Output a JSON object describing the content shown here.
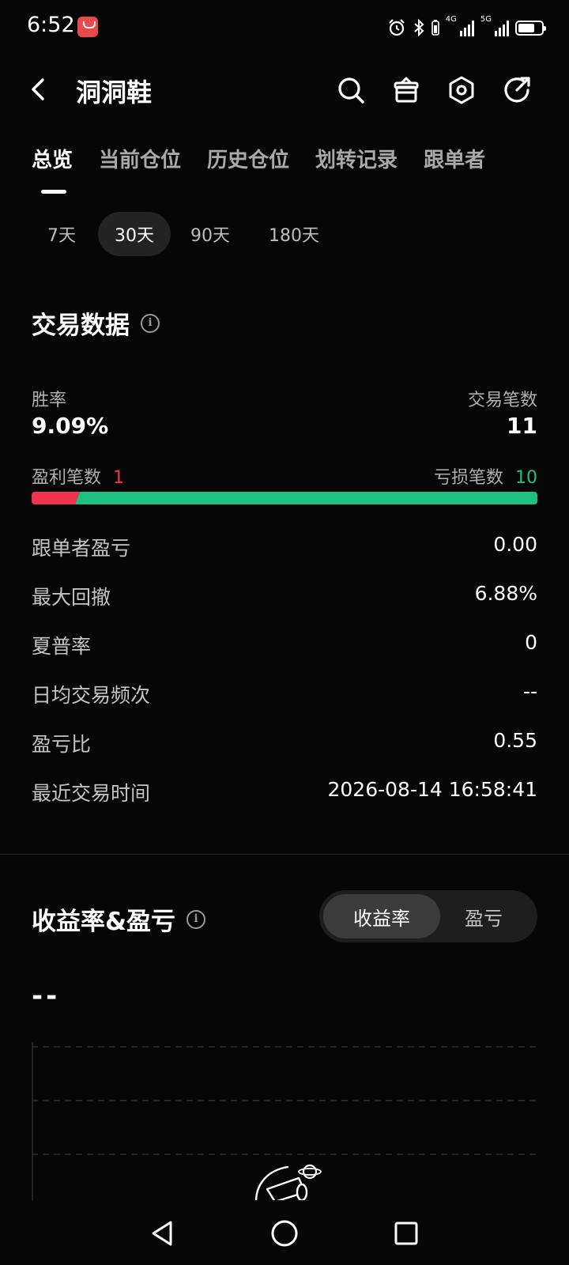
{
  "status_bar": {
    "time": "6:52",
    "network_1": "4G",
    "network_2": "5G"
  },
  "header": {
    "title": "洞洞鞋",
    "icons": [
      "back-icon",
      "search-icon",
      "gift-icon",
      "settings-icon",
      "share-icon"
    ]
  },
  "tabs": [
    {
      "label": "总览",
      "active": true
    },
    {
      "label": "当前仓位",
      "active": false
    },
    {
      "label": "历史仓位",
      "active": false
    },
    {
      "label": "划转记录",
      "active": false
    },
    {
      "label": "跟单者",
      "active": false
    }
  ],
  "periods": [
    {
      "label": "7天",
      "active": false
    },
    {
      "label": "30天",
      "active": true
    },
    {
      "label": "90天",
      "active": false
    },
    {
      "label": "180天",
      "active": false
    }
  ],
  "trading_data": {
    "title": "交易数据",
    "win_rate_label": "胜率",
    "win_rate": "9.09%",
    "trade_count_label": "交易笔数",
    "trade_count": "11",
    "profit_trades_label": "盈利笔数",
    "profit_trades": "1",
    "loss_trades_label": "亏损笔数",
    "loss_trades": "10",
    "profit_ratio": 0.0909,
    "rows": [
      {
        "key": "跟单者盈亏",
        "value": "0.00"
      },
      {
        "key": "最大回撤",
        "value": "6.88%"
      },
      {
        "key": "夏普率",
        "value": "0"
      },
      {
        "key": "日均交易频次",
        "value": "--"
      },
      {
        "key": "盈亏比",
        "value": "0.55"
      },
      {
        "key": "最近交易时间",
        "value": "2026-08-14 16:58:41"
      }
    ]
  },
  "returns": {
    "title": "收益率&盈亏",
    "toggle": [
      {
        "label": "收益率",
        "active": true
      },
      {
        "label": "盈亏",
        "active": false
      }
    ],
    "value": "--"
  },
  "colors": {
    "background": "#060606",
    "profit": "#f0344e",
    "loss": "#1ec181",
    "muted": "#b0b0b0"
  }
}
